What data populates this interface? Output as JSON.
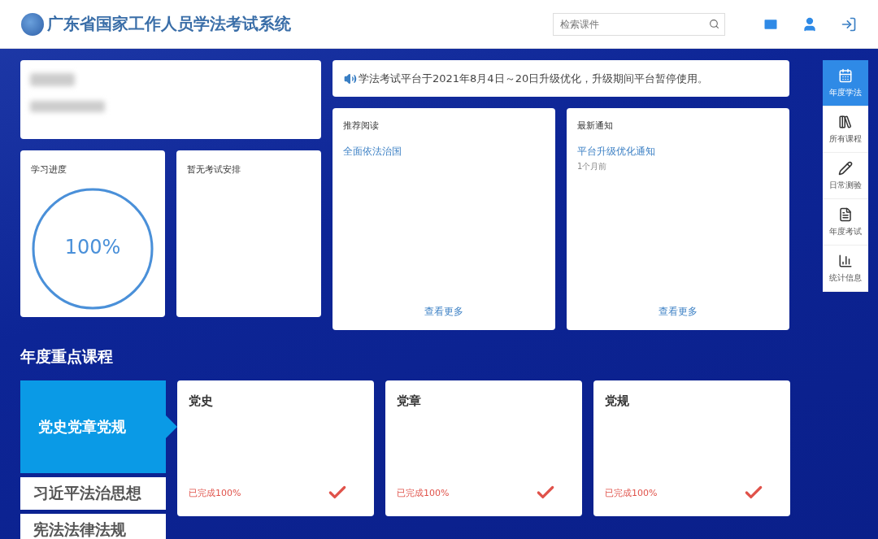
{
  "header": {
    "title": "广东省国家工作人员学法考试系统",
    "search": {
      "placeholder": "检索课件"
    }
  },
  "progress": {
    "title": "学习进度",
    "level": 1,
    "reading": "100%"
  },
  "exam": {
    "title": "暂无考试安排"
  },
  "notice": "学法考试平台于2021年8月4日～20日升级优化，升级期间平台暂停使用。",
  "panels": [
    {
      "title": "推荐阅读",
      "items": [
        {
          "link": "全面依法治国"
        }
      ],
      "more": "查看更多"
    },
    {
      "title": "最新通知",
      "items": [
        {
          "link": "平台升级优化通知",
          "time": "1个月前"
        }
      ],
      "more": "查看更多"
    }
  ],
  "sidebar": [
    {
      "kind": "calendar",
      "label": "年度学法",
      "selected": true
    },
    {
      "kind": "library",
      "label": "所有课程",
      "selected": false
    },
    {
      "kind": "pencil",
      "label": "日常测验",
      "selected": false
    },
    {
      "kind": "document",
      "label": "年度考试",
      "selected": false
    },
    {
      "kind": "chart",
      "label": "统计信息",
      "selected": false
    }
  ],
  "section_title": "年度重点课程",
  "course_tabs": [
    {
      "label": "党史党章党规",
      "selected": true
    },
    {
      "label": "习近平法治思想",
      "selected": false
    },
    {
      "label": "宪法法律法规",
      "selected": false
    }
  ],
  "courses": [
    {
      "title": "党史",
      "status": "已完成100%",
      "done": true
    },
    {
      "title": "党章",
      "status": "已完成100%",
      "done": true
    },
    {
      "title": "党规",
      "status": "已完成100%",
      "done": true
    }
  ]
}
